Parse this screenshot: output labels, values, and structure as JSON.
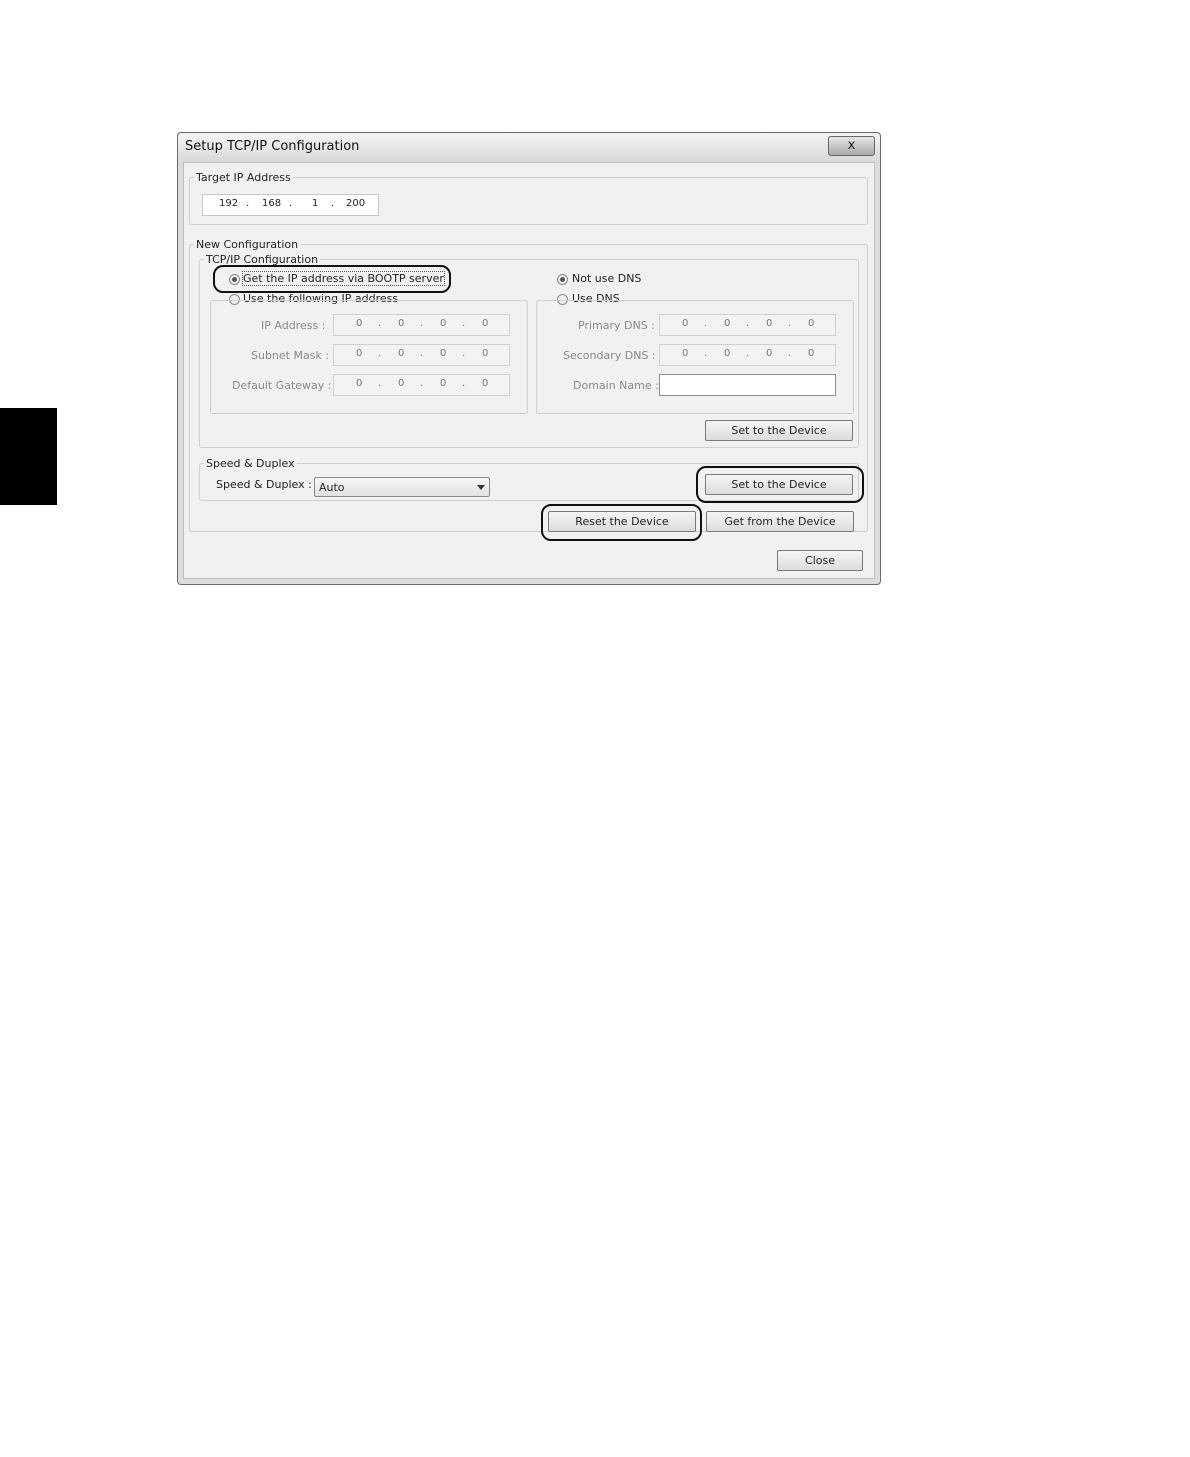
{
  "window": {
    "title": "Setup TCP/IP Configuration",
    "close_glyph": "x"
  },
  "target_ip": {
    "group_label": "Target IP Address",
    "octets": [
      "192",
      "168",
      "1",
      "200"
    ]
  },
  "new_config": {
    "group_label": "New Configuration",
    "tcpip": {
      "group_label": "TCP/IP Configuration",
      "bootp_label": "Get the IP address via BOOTP server",
      "bootp_selected": true,
      "static_label": "Use the following IP address",
      "static_selected": false,
      "fields": [
        {
          "label": "IP Address :",
          "octets": [
            "0",
            "0",
            "0",
            "0"
          ]
        },
        {
          "label": "Subnet Mask :",
          "octets": [
            "0",
            "0",
            "0",
            "0"
          ]
        },
        {
          "label": "Default Gateway :",
          "octets": [
            "0",
            "0",
            "0",
            "0"
          ]
        }
      ]
    },
    "dns": {
      "not_use_label": "Not use DNS",
      "not_use_selected": true,
      "use_label": "Use DNS",
      "use_selected": false,
      "fields": [
        {
          "label": "Primary DNS :",
          "octets": [
            "0",
            "0",
            "0",
            "0"
          ]
        },
        {
          "label": "Secondary DNS :",
          "octets": [
            "0",
            "0",
            "0",
            "0"
          ]
        }
      ],
      "domain_label": "Domain Name :",
      "domain_value": ""
    },
    "set_button_label": "Set to the Device",
    "speed": {
      "group_label": "Speed & Duplex",
      "label": "Speed & Duplex :",
      "value": "Auto",
      "set_button_label": "Set to the Device"
    },
    "reset_button_label": "Reset the Device",
    "get_button_label": "Get from the Device"
  },
  "close_button_label": "Close",
  "ip_separator": "."
}
